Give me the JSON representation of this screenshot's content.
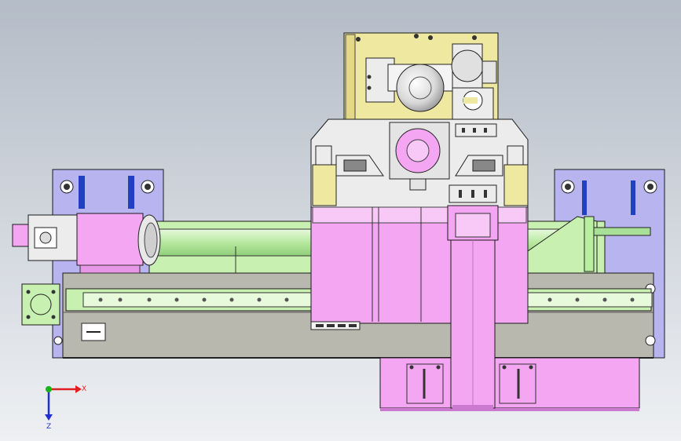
{
  "viewport": {
    "background_top": "#b4bcc7",
    "background_bottom": "#eef0f3"
  },
  "axis_triad": {
    "x_label": "X",
    "z_label": "Z",
    "x_color": "#e02020",
    "y_color": "#18b418",
    "z_color": "#2030d0"
  },
  "colors": {
    "column_yellow": "#efe8a0",
    "ram_pink": "#f4a6f2",
    "rail_green": "#c8f0b0",
    "base_violet": "#b8b4f0",
    "base_grey": "#b9b8ae",
    "housing_grey": "#ececec",
    "outline": "#1a1a1a"
  }
}
